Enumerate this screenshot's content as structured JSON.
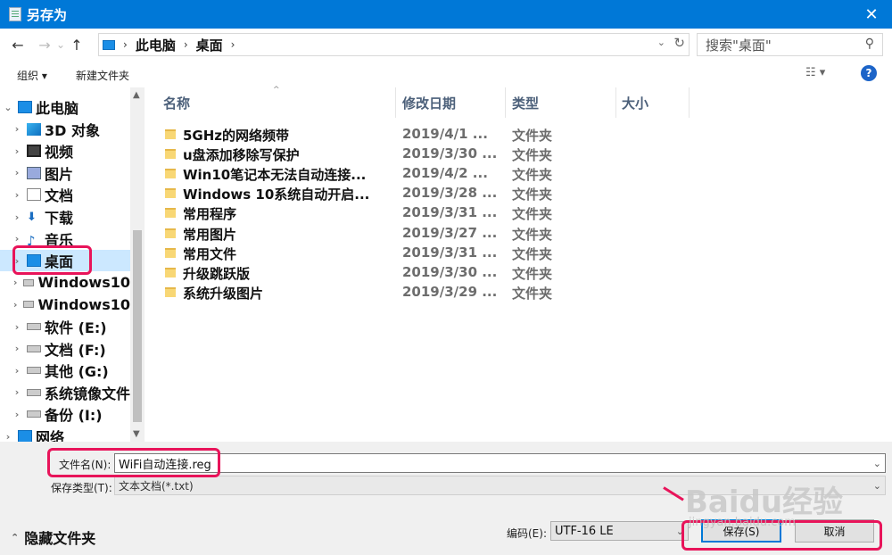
{
  "window": {
    "title": "另存为",
    "close": "✕"
  },
  "nav": {
    "back": "←",
    "forward": "→",
    "recent": "⌄",
    "up": "↑",
    "breadcrumb": [
      "此电脑",
      "桌面"
    ],
    "separator": "›",
    "dropdown": "⌄",
    "refresh": "↻",
    "search_placeholder": "搜索\"桌面\"",
    "search_icon": "⚲"
  },
  "toolbar": {
    "organize": "组织 ▾",
    "new_folder": "新建文件夹",
    "view": "☷ ▾",
    "help": "?"
  },
  "tree": [
    {
      "chev": "⌄",
      "icon": "pc",
      "label": "此电脑",
      "indent": 0
    },
    {
      "chev": "›",
      "icon": "3d",
      "label": "3D 对象",
      "indent": 1
    },
    {
      "chev": "›",
      "icon": "video",
      "label": "视频",
      "indent": 1
    },
    {
      "chev": "›",
      "icon": "pic",
      "label": "图片",
      "indent": 1
    },
    {
      "chev": "›",
      "icon": "doc",
      "label": "文档",
      "indent": 1
    },
    {
      "chev": "›",
      "icon": "dl",
      "label": "下载",
      "indent": 1
    },
    {
      "chev": "›",
      "icon": "music",
      "label": "音乐",
      "indent": 1
    },
    {
      "chev": "›",
      "icon": "desk",
      "label": "桌面",
      "indent": 1,
      "selected": true
    },
    {
      "chev": "›",
      "icon": "drive",
      "label": "Windows10",
      "indent": 1
    },
    {
      "chev": "›",
      "icon": "drive",
      "label": "Windows10",
      "indent": 1
    },
    {
      "chev": "›",
      "icon": "drive",
      "label": "软件 (E:)",
      "indent": 1
    },
    {
      "chev": "›",
      "icon": "drive",
      "label": "文档 (F:)",
      "indent": 1
    },
    {
      "chev": "›",
      "icon": "drive",
      "label": "其他 (G:)",
      "indent": 1
    },
    {
      "chev": "›",
      "icon": "drive",
      "label": "系统镜像文件",
      "indent": 1
    },
    {
      "chev": "›",
      "icon": "drive",
      "label": "备份 (I:)",
      "indent": 1
    },
    {
      "chev": "›",
      "icon": "pc",
      "label": "网络",
      "indent": 0
    }
  ],
  "columns": {
    "name": "名称",
    "date": "修改日期",
    "type": "类型",
    "size": "大小",
    "sort": "^"
  },
  "files": [
    {
      "name": "5GHz的网络频带",
      "date": "2019/4/1 ...",
      "type": "文件夹"
    },
    {
      "name": "u盘添加移除写保护",
      "date": "2019/3/30 ...",
      "type": "文件夹"
    },
    {
      "name": "Win10笔记本无法自动连接...",
      "date": "2019/4/2 ...",
      "type": "文件夹"
    },
    {
      "name": "Windows 10系统自动开启...",
      "date": "2019/3/28 ...",
      "type": "文件夹"
    },
    {
      "name": "常用程序",
      "date": "2019/3/31 ...",
      "type": "文件夹"
    },
    {
      "name": "常用图片",
      "date": "2019/3/27 ...",
      "type": "文件夹"
    },
    {
      "name": "常用文件",
      "date": "2019/3/31 ...",
      "type": "文件夹"
    },
    {
      "name": "升级跳跃版",
      "date": "2019/3/30 ...",
      "type": "文件夹"
    },
    {
      "name": "系统升级图片",
      "date": "2019/3/29 ...",
      "type": "文件夹"
    }
  ],
  "save": {
    "filename_label": "文件名(N):",
    "filename_value": "WiFi自动连接.reg",
    "type_label": "保存类型(T):",
    "type_value": "文本文档(*.txt)",
    "hide_folders": "隐藏文件夹",
    "encoding_label": "编码(E):",
    "encoding_value": "UTF-16 LE",
    "save_button": "保存(S)",
    "cancel_button": "取消"
  },
  "watermark": {
    "brand": "Baidu经验",
    "url": "jingyan.baidu.com"
  },
  "colors": {
    "titlebar": "#0078d7",
    "highlight": "#e8145a",
    "selection": "#cce8ff"
  }
}
